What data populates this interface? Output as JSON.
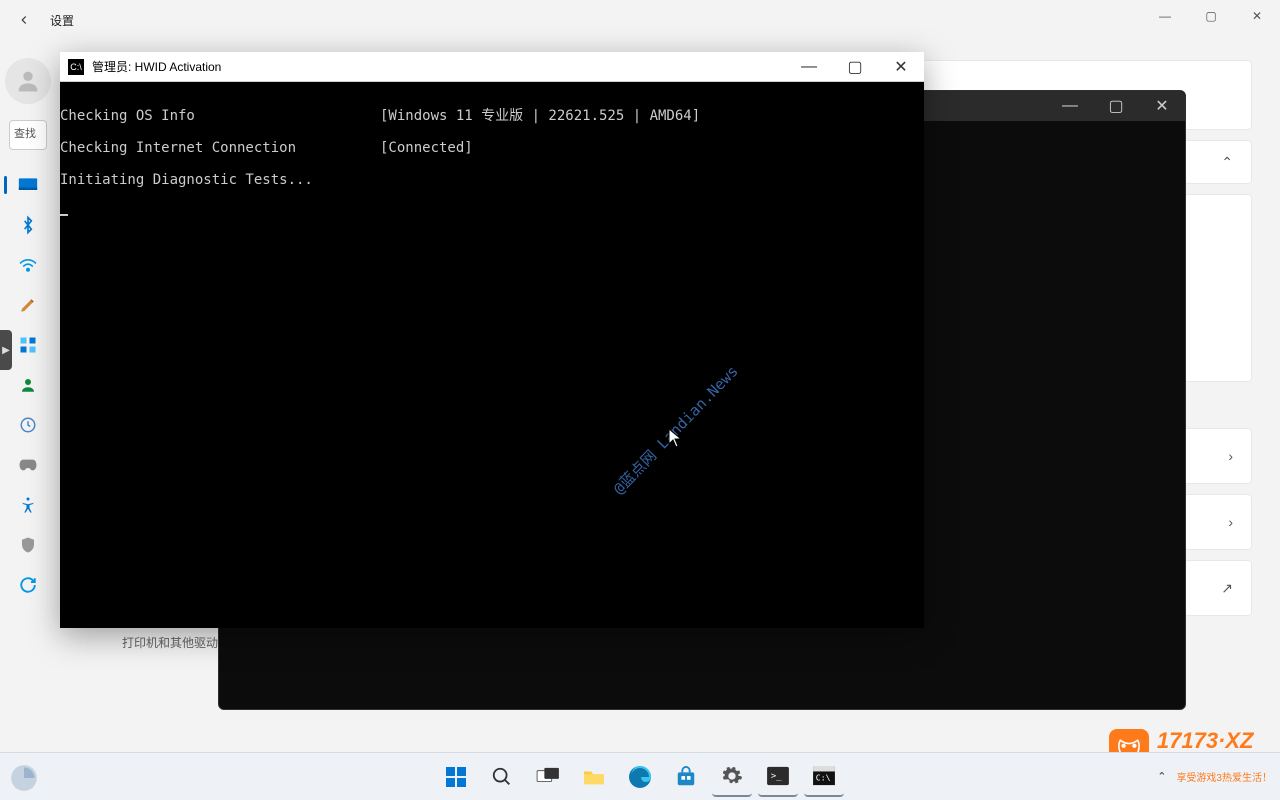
{
  "settings": {
    "title": "设置",
    "search_placeholder": "查找",
    "sidebar_icons": [
      "system-icon",
      "bluetooth-icon",
      "network-icon",
      "personalization-icon",
      "apps-icon",
      "accounts-icon",
      "time-icon",
      "gaming-icon",
      "accessibility-icon",
      "privacy-icon",
      "update-icon"
    ],
    "visible_subtitle": "打印机和其他驱动程序、硬件属性"
  },
  "mid_window": {
    "controls": {
      "min": "—",
      "max": "▢",
      "close": "✕"
    }
  },
  "console": {
    "title": "管理员:   HWID Activation",
    "controls": {
      "min": "—",
      "max": "▢",
      "close": "✕"
    },
    "lines": [
      {
        "left": "Checking OS Info",
        "right": "[Windows 11 专业版 | 22621.525 | AMD64]"
      },
      {
        "left": "Checking Internet Connection",
        "right": "[Connected]"
      },
      {
        "left": "Initiating Diagnostic Tests...",
        "right": ""
      }
    ],
    "watermark": "@蓝点网 Landian.News"
  },
  "taskbar": {
    "items": [
      "start-icon",
      "search-icon",
      "taskview-icon",
      "explorer-icon",
      "edge-icon",
      "store-icon",
      "settings-icon",
      "terminal-icon",
      "cmd-icon"
    ],
    "tray_tip": "享受游戏3热爱生活！"
  },
  "site_logo": {
    "main": "17173·XZ",
    "sub": "享受游戏3热爱生活！"
  },
  "win_controls": {
    "min": "—",
    "max": "▢",
    "close": "✕"
  }
}
